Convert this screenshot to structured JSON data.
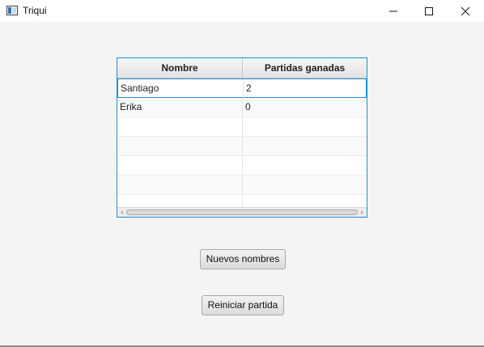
{
  "window": {
    "title": "Triqui",
    "app_icon": "java-app-icon",
    "controls": {
      "minimize_icon": "minimize-icon",
      "maximize_icon": "maximize-icon",
      "close_icon": "close-icon"
    }
  },
  "table": {
    "columns": [
      "Nombre",
      "Partidas ganadas"
    ],
    "rows": [
      {
        "nombre": "Santiago",
        "partidas": "2",
        "selected": true
      },
      {
        "nombre": "Erika",
        "partidas": "0",
        "selected": false
      }
    ],
    "scrollbar": {
      "left_arrow": "‹",
      "right_arrow": "›"
    }
  },
  "buttons": {
    "nuevos_nombres": "Nuevos nombres",
    "reiniciar_partida": "Reiniciar partida"
  },
  "colors": {
    "focus_border": "#1e8fd3",
    "background": "#f4f4f4"
  }
}
